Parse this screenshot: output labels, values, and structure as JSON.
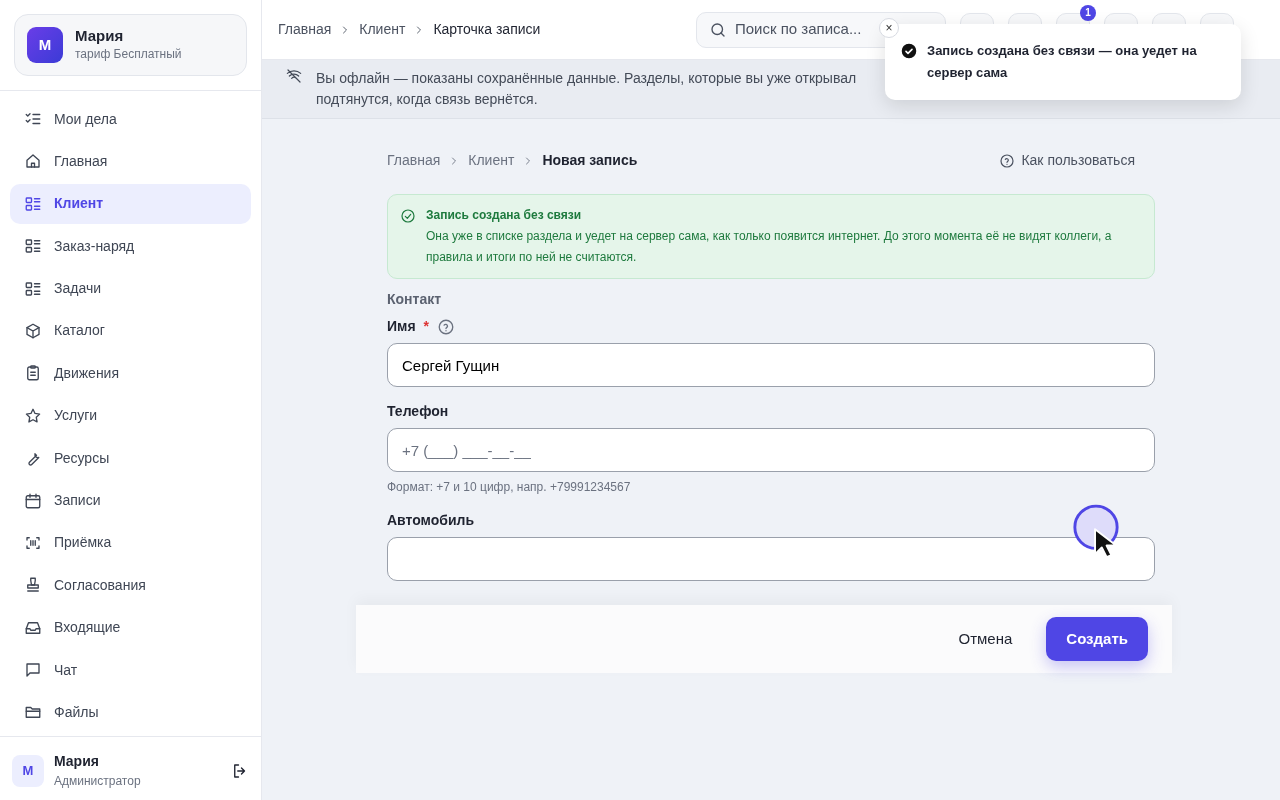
{
  "workspace": {
    "avatar": "М",
    "name": "Мария",
    "plan": "тариф Бесплатный"
  },
  "sidebar": {
    "items": [
      {
        "label": "Мои дела",
        "selected": false
      },
      {
        "label": "Главная",
        "selected": false
      },
      {
        "label": "Клиент",
        "selected": true
      },
      {
        "label": "Заказ-наряд",
        "selected": false
      },
      {
        "label": "Задачи",
        "selected": false
      },
      {
        "label": "Каталог",
        "selected": false
      },
      {
        "label": "Движения",
        "selected": false
      },
      {
        "label": "Услуги",
        "selected": false
      },
      {
        "label": "Ресурсы",
        "selected": false
      },
      {
        "label": "Записи",
        "selected": false
      },
      {
        "label": "Приёмка",
        "selected": false
      },
      {
        "label": "Согласования",
        "selected": false
      },
      {
        "label": "Входящие",
        "selected": false
      },
      {
        "label": "Чат",
        "selected": false
      },
      {
        "label": "Файлы",
        "selected": false
      }
    ]
  },
  "user": {
    "avatar": "М",
    "name": "Мария",
    "role": "Администратор"
  },
  "topbar": {
    "breadcrumbs": [
      "Главная",
      "Клиент",
      "Карточка записи"
    ],
    "search": {
      "placeholder": "Поиск по записа..."
    },
    "notification_count": "1"
  },
  "offline_banner": {
    "lines": [
      "Вы офлайн — показаны сохранённые данные. Разделы, которые вы уже открывал",
      "подтянутся, когда связь вернётся."
    ]
  },
  "toast": {
    "close": "×",
    "text": "Запись создана без связи — она уедет на сервер сама"
  },
  "page": {
    "breadcrumbs": [
      "Главная",
      "Клиент",
      "Новая запись"
    ],
    "help": "Как пользоваться"
  },
  "alert": {
    "title": "Запись создана без связи",
    "text": "Она уже в списке раздела и уедет на сервер сама, как только появится интернет. До этого момента её не видят коллеги, а правила и итоги по ней не считаются."
  },
  "form": {
    "section": "Контакт",
    "required_mark": "*",
    "fields": [
      {
        "label": "Имя",
        "required": true,
        "help": true,
        "value": "Сергей Гущин"
      },
      {
        "label": "Телефон",
        "required": false,
        "help": false,
        "placeholder": "+7 (___) ___-__-__",
        "hint": "Формат: +7 и 10 цифр, напр. +79991234567"
      },
      {
        "label": "Автомобиль",
        "required": false,
        "help": false
      }
    ]
  },
  "actions": {
    "cancel": "Отмена",
    "submit": "Создать"
  }
}
